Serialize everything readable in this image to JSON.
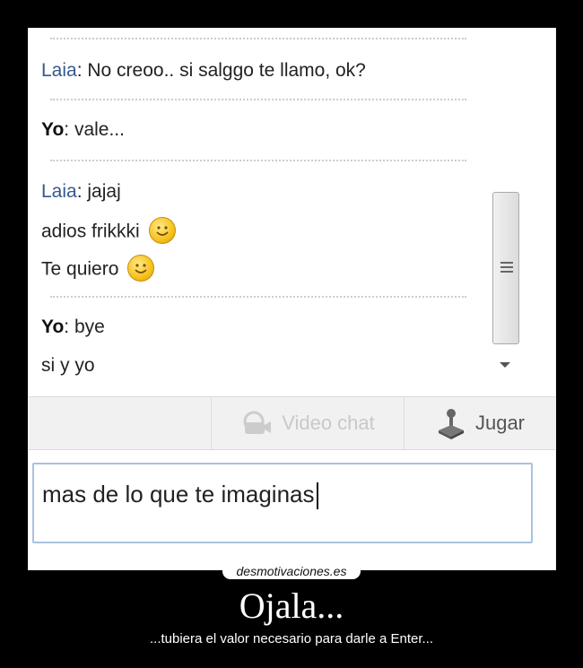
{
  "chat": {
    "messages": [
      {
        "sender": "Laia",
        "lines": [
          "No creoo.. si salggo te llamo, ok?"
        ]
      },
      {
        "sender": "Yo",
        "lines": [
          "vale..."
        ]
      },
      {
        "sender": "Laia",
        "lines": [
          "jajaj",
          "adios frikkki",
          "Te quiero"
        ]
      },
      {
        "sender": "Yo",
        "lines": [
          "bye",
          "si y yo"
        ]
      }
    ],
    "separator": ": "
  },
  "toolbar": {
    "video_chat_label": "Video chat",
    "jugar_label": "Jugar"
  },
  "input": {
    "value": "mas de lo que te imaginas"
  },
  "poster": {
    "brand": "desmotivaciones.es",
    "title": "Ojala...",
    "subtitle": "...tubiera el valor necesario para darle a Enter..."
  },
  "icons": {
    "smiley": "smiley-emoticon-icon",
    "video": "video-chat-icon",
    "joystick": "joystick-icon",
    "scroll_down": "scroll-down-arrow-icon"
  },
  "colors": {
    "sender_laia": "#35598f",
    "input_border": "#a9c2df",
    "poster_bg": "#000000"
  }
}
